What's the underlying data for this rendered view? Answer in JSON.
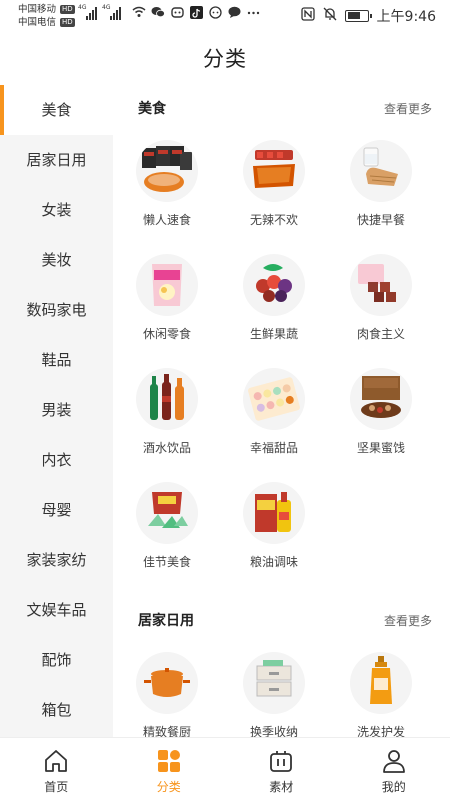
{
  "status_bar": {
    "carrier1": "中国移动",
    "carrier2": "中国电信",
    "hd": "HD",
    "net1": "4G",
    "net2": "4G",
    "time": "上午9:46"
  },
  "header": {
    "title": "分类"
  },
  "sidebar": {
    "items": [
      {
        "label": "美食",
        "active": true
      },
      {
        "label": "居家日用"
      },
      {
        "label": "女装"
      },
      {
        "label": "美妆"
      },
      {
        "label": "数码家电"
      },
      {
        "label": "鞋品"
      },
      {
        "label": "男装"
      },
      {
        "label": "内衣"
      },
      {
        "label": "母婴"
      },
      {
        "label": "家装家纺"
      },
      {
        "label": "文娱车品"
      },
      {
        "label": "配饰"
      },
      {
        "label": "箱包"
      }
    ]
  },
  "sections": [
    {
      "title": "美食",
      "more": "查看更多",
      "items": [
        {
          "label": "懒人速食"
        },
        {
          "label": "无辣不欢"
        },
        {
          "label": "快捷早餐"
        },
        {
          "label": "休闲零食"
        },
        {
          "label": "生鲜果蔬"
        },
        {
          "label": "肉食主义"
        },
        {
          "label": "酒水饮品"
        },
        {
          "label": "幸福甜品"
        },
        {
          "label": "坚果蜜饯"
        },
        {
          "label": "佳节美食"
        },
        {
          "label": "粮油调味"
        }
      ]
    },
    {
      "title": "居家日用",
      "more": "查看更多",
      "items": [
        {
          "label": "精致餐厨"
        },
        {
          "label": "换季收纳"
        },
        {
          "label": "洗发护发"
        }
      ]
    }
  ],
  "bottom_nav": {
    "items": [
      {
        "label": "首页",
        "icon": "home-icon"
      },
      {
        "label": "分类",
        "icon": "category-icon",
        "active": true
      },
      {
        "label": "素材",
        "icon": "material-icon"
      },
      {
        "label": "我的",
        "icon": "profile-icon"
      }
    ]
  },
  "colors": {
    "accent": "#f7941d"
  }
}
